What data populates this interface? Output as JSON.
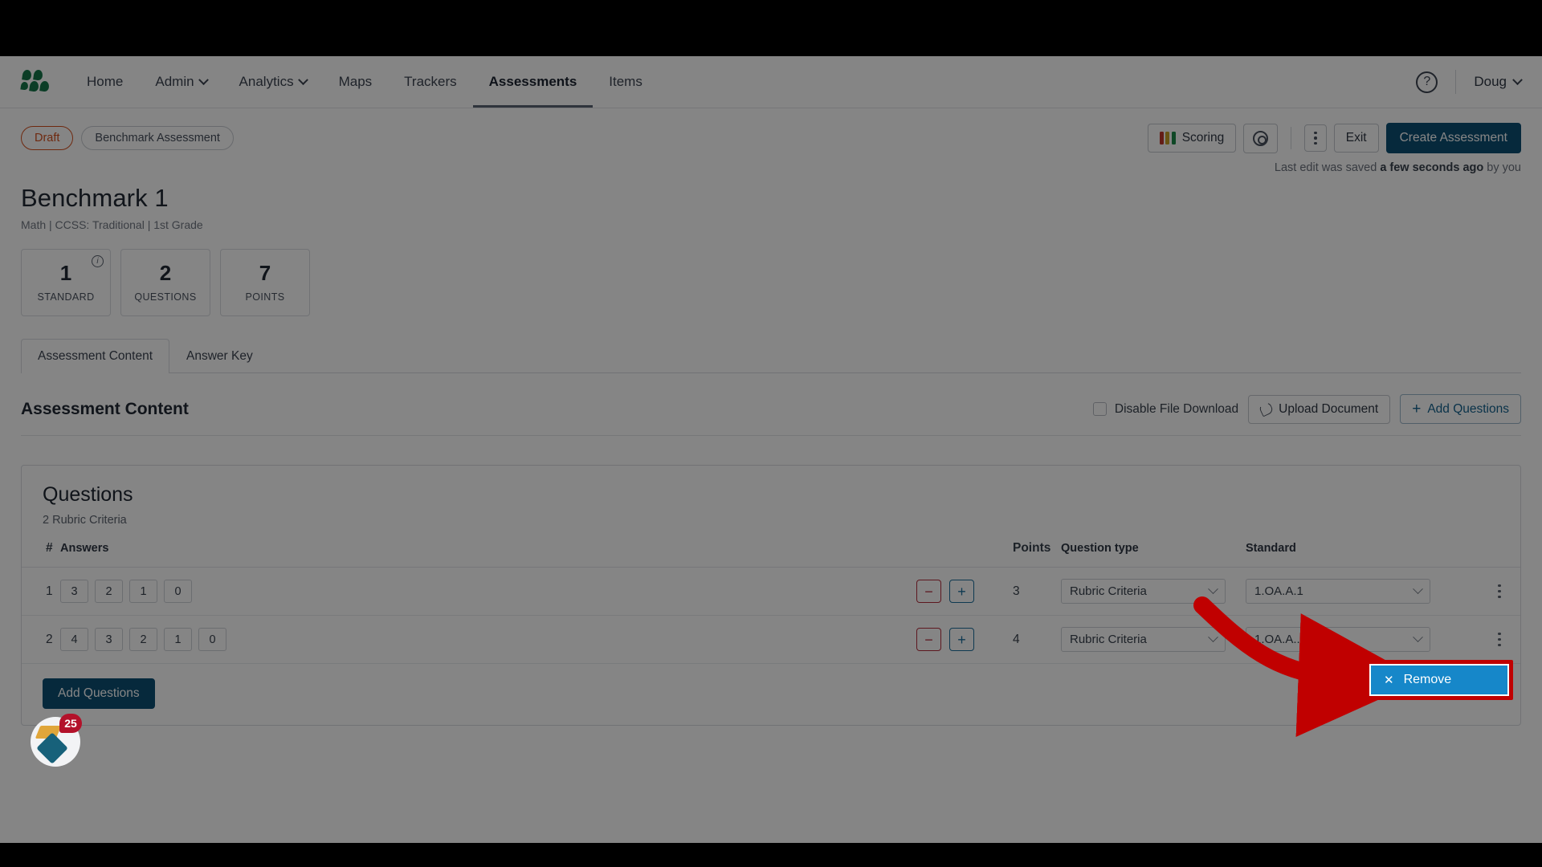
{
  "nav": {
    "logo_icon": "leaf-cluster-logo",
    "items": [
      {
        "label": "Home",
        "has_caret": false,
        "active": false
      },
      {
        "label": "Admin",
        "has_caret": true,
        "active": false
      },
      {
        "label": "Analytics",
        "has_caret": true,
        "active": false
      },
      {
        "label": "Maps",
        "has_caret": false,
        "active": false
      },
      {
        "label": "Trackers",
        "has_caret": false,
        "active": false
      },
      {
        "label": "Assessments",
        "has_caret": false,
        "active": true
      },
      {
        "label": "Items",
        "has_caret": false,
        "active": false
      }
    ],
    "help_icon": "question-mark-circle-icon",
    "user": "Doug",
    "user_caret_icon": "chevron-down-icon"
  },
  "actionbar": {
    "status_badge": "Draft",
    "type_badge": "Benchmark Assessment",
    "scoring_label": "Scoring",
    "scoring_icon": "scoring-bars-icon",
    "settings_icon": "gear-icon",
    "more_icon": "kebab-menu-icon",
    "exit_label": "Exit",
    "create_label": "Create Assessment",
    "saved_prefix": "Last edit was saved ",
    "saved_time": "a few seconds ago",
    "saved_suffix": " by you"
  },
  "header": {
    "title": "Benchmark 1",
    "subtitle": "Math  |  CCSS: Traditional  |  1st Grade"
  },
  "stats": [
    {
      "value": "1",
      "label": "STANDARD",
      "info_icon": "info-circle-icon"
    },
    {
      "value": "2",
      "label": "QUESTIONS",
      "info_icon": null
    },
    {
      "value": "7",
      "label": "POINTS",
      "info_icon": null
    }
  ],
  "tabs": [
    {
      "label": "Assessment Content",
      "active": true
    },
    {
      "label": "Answer Key",
      "active": false
    }
  ],
  "content_header": {
    "heading": "Assessment Content",
    "disable_download_label": "Disable File Download",
    "disable_download_checked": false,
    "upload_label": "Upload Document",
    "upload_icon": "paperclip-icon",
    "add_questions_label": "Add Questions",
    "add_questions_icon": "plus-icon"
  },
  "questions_card": {
    "heading": "Questions",
    "subheading": "2 Rubric Criteria",
    "columns": [
      "#",
      "Answers",
      "",
      "Points",
      "Question type",
      "Standard",
      ""
    ],
    "rows": [
      {
        "num": "1",
        "answers": [
          "3",
          "2",
          "1",
          "0"
        ],
        "minus_icon": "minus-icon",
        "plus_icon": "plus-icon",
        "points": "3",
        "question_type": "Rubric Criteria",
        "standard": "1.OA.A.1",
        "row_menu_icon": "kebab-menu-icon"
      },
      {
        "num": "2",
        "answers": [
          "4",
          "3",
          "2",
          "1",
          "0"
        ],
        "minus_icon": "minus-icon",
        "plus_icon": "plus-icon",
        "points": "4",
        "question_type": "Rubric Criteria",
        "standard": "1.OA.A...",
        "row_menu_icon": "kebab-menu-icon"
      }
    ],
    "footer_button": "Add Questions"
  },
  "launcher": {
    "badge_count": "25",
    "icon": "app-launcher-icon"
  },
  "annotation": {
    "arrow_icon": "red-curved-arrow",
    "menu_item_label": "Remove",
    "menu_item_icon": "close-x-icon",
    "highlight_color": "#c00000"
  },
  "colors": {
    "primary": "#0d4f74",
    "link": "#15628e",
    "draft": "#d4501e",
    "minus": "#b32c3c",
    "plus": "#1b6e9b",
    "logo_green": "#16764a",
    "remove_blue": "#1687c9",
    "badge_red": "#b3112a"
  }
}
